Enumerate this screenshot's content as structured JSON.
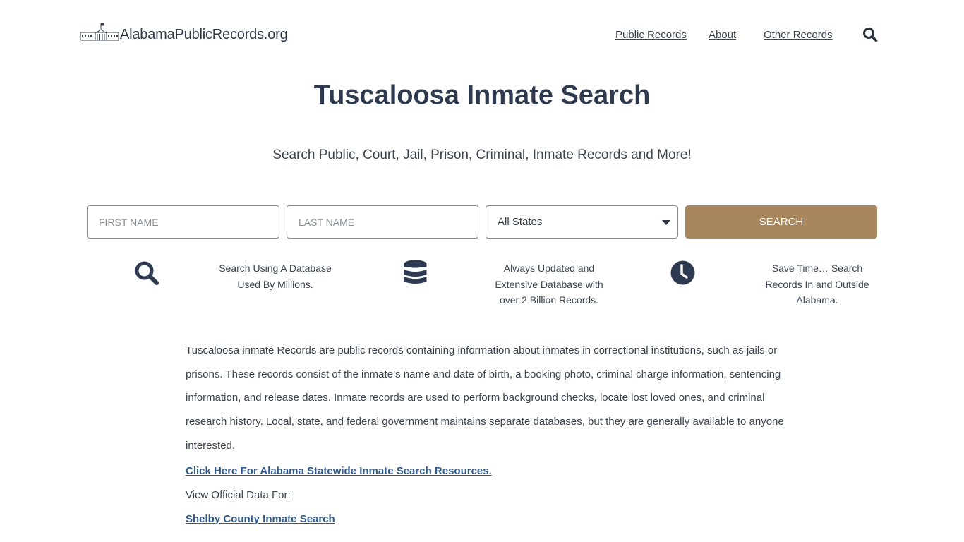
{
  "site": {
    "logo_text": "AlabamaPublicRecords.org",
    "logo_icon": "capitol-building-icon"
  },
  "nav": {
    "items": [
      {
        "label": "Public Records"
      },
      {
        "label": "About"
      },
      {
        "label": "Other Records"
      }
    ],
    "search_icon": "search-icon"
  },
  "hero": {
    "title": "Tuscaloosa Inmate Search",
    "subtitle": "Search Public, Court, Jail, Prison, Criminal, Inmate Records and More!"
  },
  "search_form": {
    "first_name": {
      "value": "",
      "placeholder": "FIRST NAME"
    },
    "last_name": {
      "value": "",
      "placeholder": "LAST NAME"
    },
    "state_select": {
      "selected": "All States"
    },
    "submit_label": "SEARCH"
  },
  "features": [
    {
      "icon": "search-icon",
      "line1": "Search Using A Database",
      "line2": "Used By Millions.",
      "line3": ""
    },
    {
      "icon": "database-icon",
      "line1": "Always Updated and",
      "line2": "Extensive Database with",
      "line3": "over 2 Billion Records."
    },
    {
      "icon": "clock-icon",
      "line1": "Save Time… Search",
      "line2": "Records In and Outside",
      "line3": "Alabama."
    }
  ],
  "content": {
    "paragraph": "Tuscaloosa inmate Records are public records containing information about inmates in correctional institutions, such as jails or prisons. These records consist of the inmate’s name and date of birth, a booking photo, criminal charge information, sentencing information, and release dates. Inmate records are used to perform background checks, locate lost loved ones, and criminal research history. Local, state, and federal government maintains separate databases, but they are generally available to anyone interested.",
    "statewide_link": "Click Here For Alabama Statewide Inmate Search Resources.",
    "view_official_label": "View Official Data For:",
    "county_links": [
      "Shelby County Inmate Search"
    ]
  },
  "colors": {
    "accent_button": "#a8875e",
    "title_text": "#2e3a4f",
    "link": "#2f5a8c",
    "icon": "#2e3a52"
  }
}
